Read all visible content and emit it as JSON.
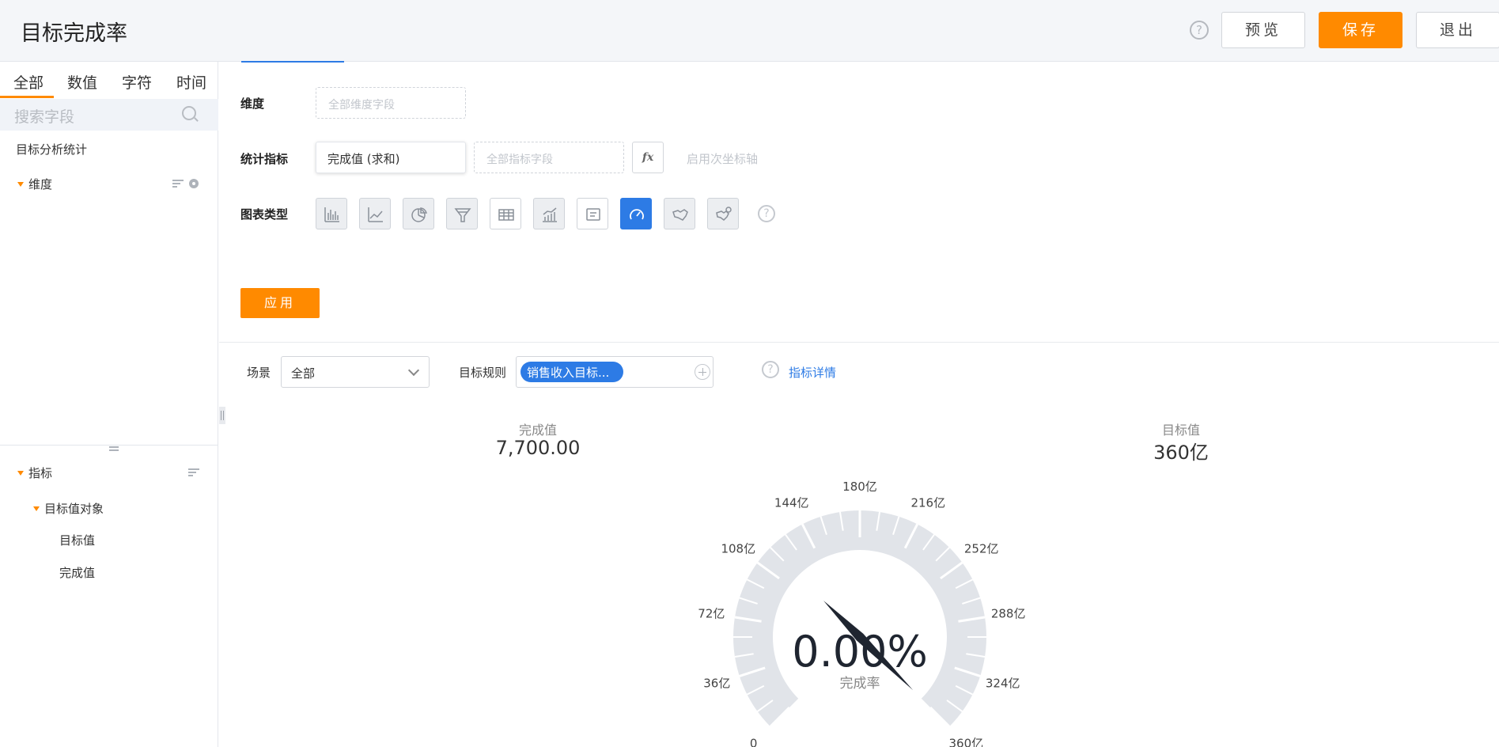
{
  "header": {
    "title": "目标完成率",
    "help_glyph": "?",
    "preview_label": "预览",
    "save_label": "保存",
    "exit_label": "退出"
  },
  "sidebar": {
    "tabs": [
      "全部",
      "数值",
      "字符",
      "时间"
    ],
    "search_placeholder": "搜索字段",
    "dataset_name": "目标分析统计",
    "dimension_group": "维度",
    "measure_group": "指标",
    "measure_subgroup": "目标值对象",
    "measure_fields": [
      "目标值",
      "完成值"
    ]
  },
  "config": {
    "dimension_label": "维度",
    "dimension_placeholder": "全部维度字段",
    "measure_label": "统计指标",
    "measure_chip": "完成值 (求和)",
    "measure_placeholder": "全部指标字段",
    "fx_label": "fx",
    "secondary_axis": "启用次坐标轴",
    "chart_type_label": "图表类型",
    "chart_types": [
      "bar-chart-icon",
      "line-chart-icon",
      "pie-chart-icon",
      "funnel-chart-icon",
      "table-chart-icon",
      "combo-chart-icon",
      "text-card-icon",
      "gauge-chart-icon",
      "map-icon",
      "map-point-icon"
    ],
    "selected_chart_type": "gauge-chart-icon",
    "apply_label": "应用"
  },
  "filters": {
    "scene_label": "场景",
    "scene_value": "全部",
    "rule_label": "目标规则",
    "rule_tag": "销售收入目标...",
    "detail_link": "指标详情"
  },
  "kpis": {
    "actual_label": "完成值",
    "actual_value": "7,700.00",
    "target_label": "目标值",
    "target_value": "360亿"
  },
  "gauge": {
    "min": 0,
    "max": 360,
    "unit": "亿",
    "value_percent": 0.0,
    "center_value": "0.00%",
    "center_label": "完成率",
    "tick_labels": [
      "0",
      "36亿",
      "72亿",
      "108亿",
      "144亿",
      "180亿",
      "216亿",
      "252亿",
      "288亿",
      "324亿",
      "360亿"
    ],
    "band_color": "#e1e4e9",
    "needle_color": "#1f2530"
  },
  "colors": {
    "accent_orange": "#ff8a00",
    "accent_blue": "#2d7be5"
  }
}
